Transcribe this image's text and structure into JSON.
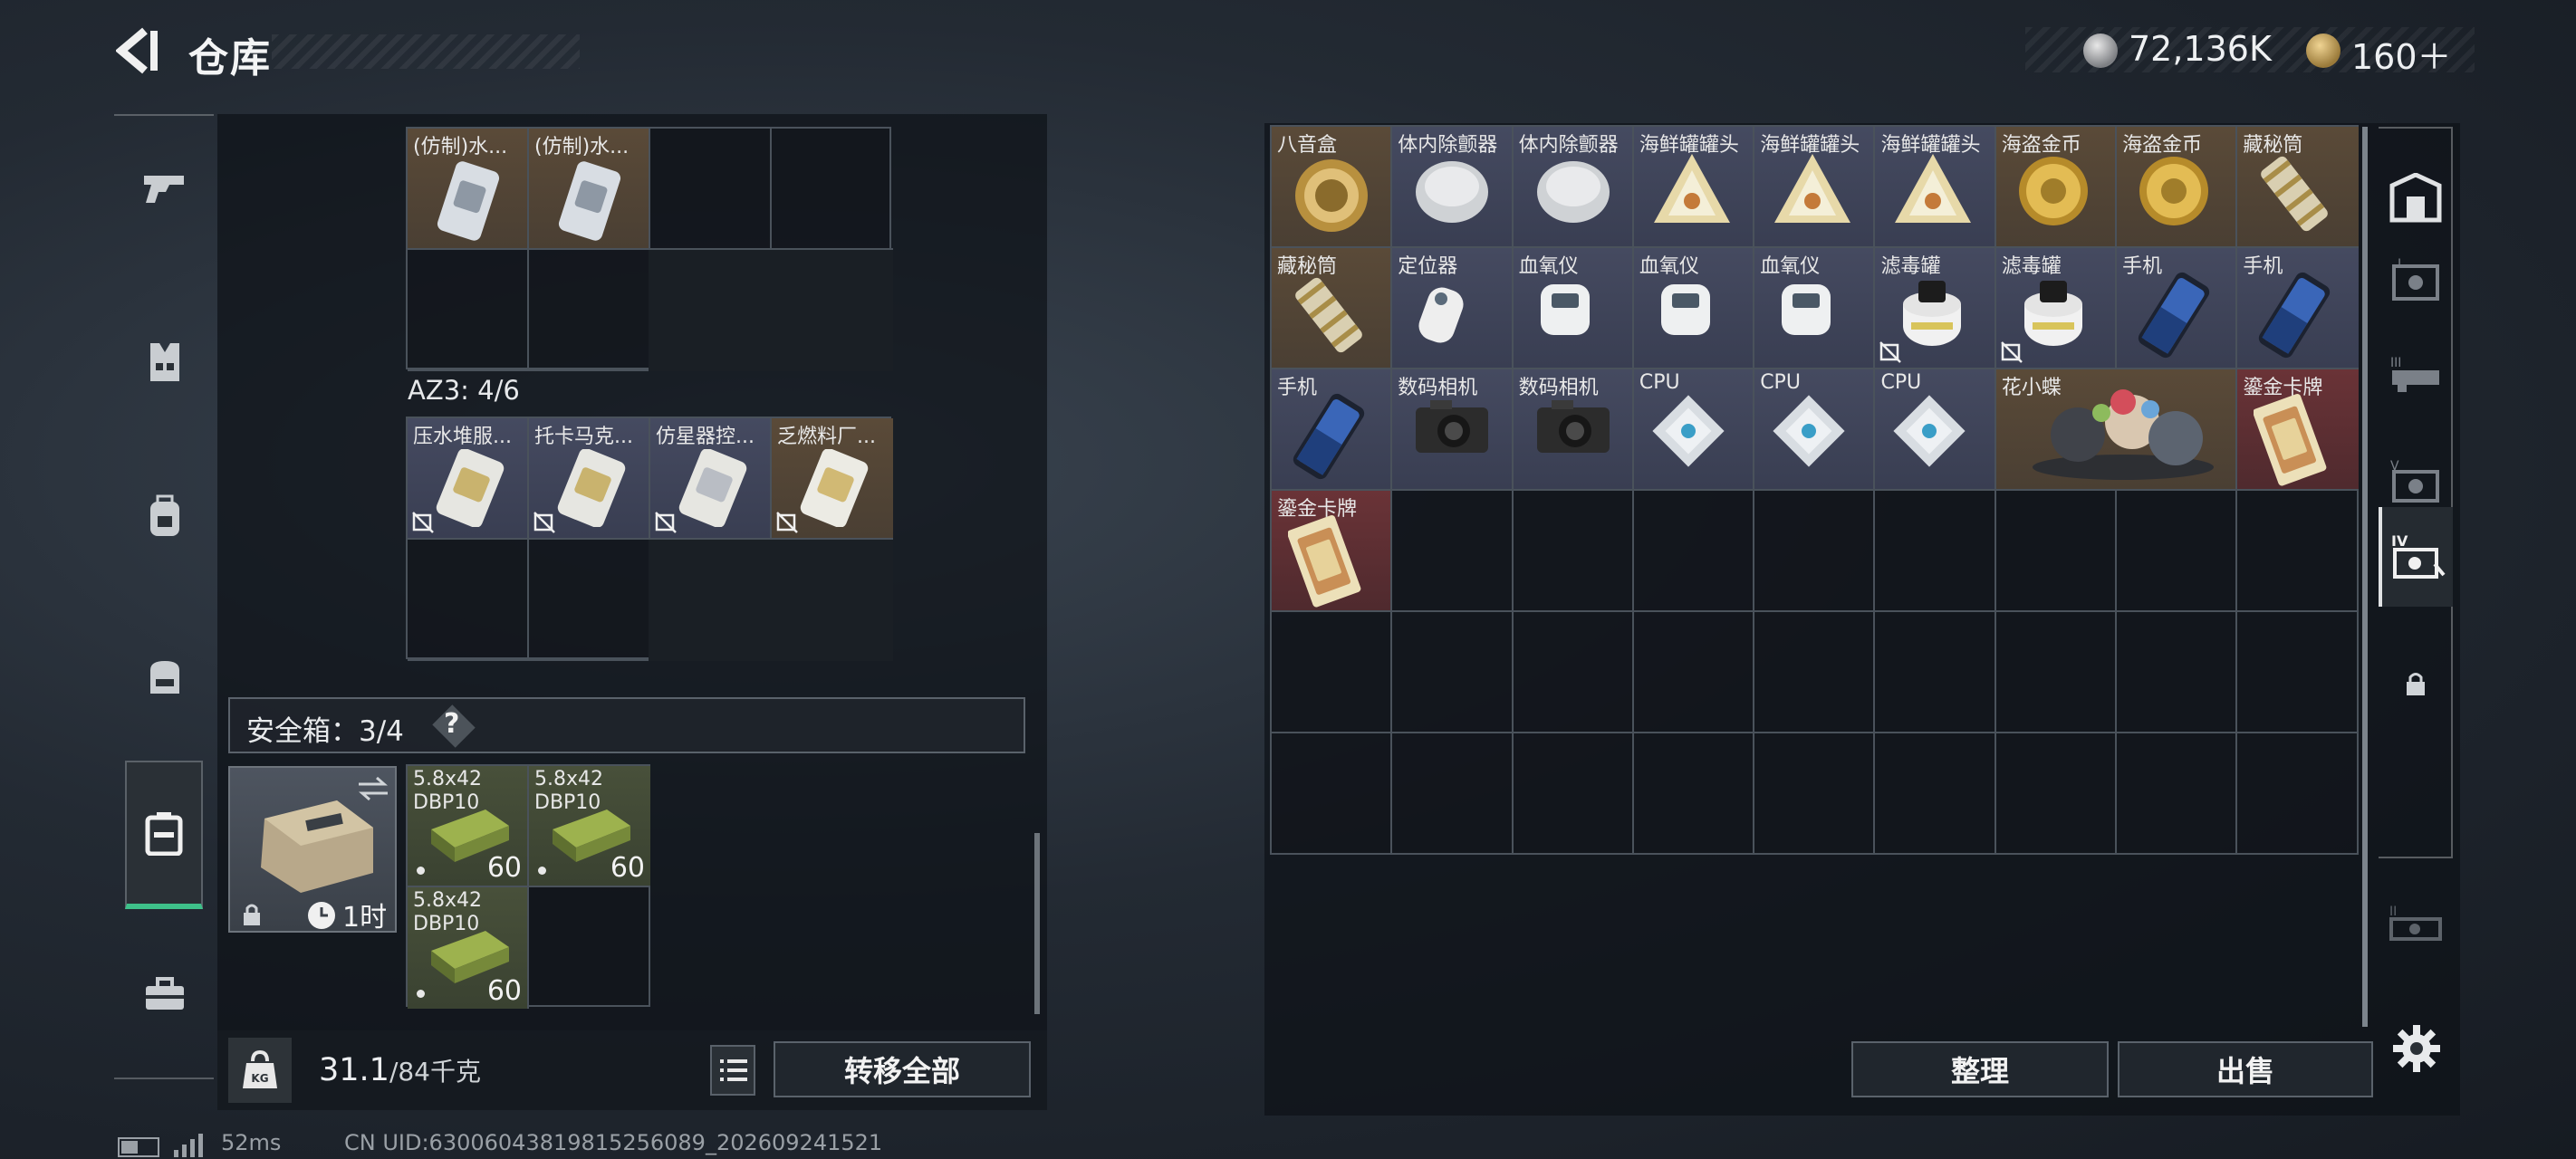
{
  "header": {
    "title": "仓库",
    "currency_main": "72,136K",
    "currency_premium": "160＋"
  },
  "left_nav": {
    "items": [
      "gun-icon",
      "armor-icon",
      "backpack-icon",
      "bag-icon",
      "safe-box-icon",
      "toolbox-icon"
    ],
    "active": "safe-box-icon"
  },
  "container_top": {
    "rows": [
      [
        {
          "name": "(仿制)水...",
          "quality": "brown"
        },
        {
          "name": "(仿制)水...",
          "quality": "brown"
        },
        null,
        null
      ],
      [
        null,
        null
      ]
    ]
  },
  "az3": {
    "label": "AZ3: 4/6",
    "items": [
      {
        "name": "压水堆服...",
        "quality": "violet"
      },
      {
        "name": "托卡马克...",
        "quality": "violet"
      },
      {
        "name": "仿星器控...",
        "quality": "violet"
      },
      {
        "name": "乏燃料厂...",
        "quality": "brown"
      }
    ]
  },
  "safe_box": {
    "label": "安全箱：3/4",
    "help": "?",
    "time_left": "1时",
    "items": [
      {
        "name": "5.8x42",
        "sub": "DBP10",
        "qty": "60"
      },
      {
        "name": "5.8x42",
        "sub": "DBP10",
        "qty": "60"
      },
      {
        "name": "5.8x42",
        "sub": "DBP10",
        "qty": "60"
      }
    ]
  },
  "bottom": {
    "weight_current": "31.1",
    "weight_max": "/84千克",
    "transfer_all": "转移全部"
  },
  "warehouse": {
    "items": [
      {
        "name": "八音盒",
        "quality": "brown",
        "art": "gold-disc"
      },
      {
        "name": "体内除颤器",
        "quality": "violet",
        "art": "silver-disc"
      },
      {
        "name": "体内除颤器",
        "quality": "violet",
        "art": "silver-disc"
      },
      {
        "name": "海鲜罐罐头",
        "quality": "violet",
        "art": "triangle"
      },
      {
        "name": "海鲜罐罐头",
        "quality": "violet",
        "art": "triangle"
      },
      {
        "name": "海鲜罐罐头",
        "quality": "violet",
        "art": "triangle"
      },
      {
        "name": "海盗金币",
        "quality": "brown",
        "art": "gold-coin"
      },
      {
        "name": "海盗金币",
        "quality": "brown",
        "art": "gold-coin"
      },
      {
        "name": "藏秘筒",
        "quality": "brown",
        "art": "cylinder"
      },
      {
        "name": "藏秘筒",
        "quality": "brown",
        "art": "cylinder"
      },
      {
        "name": "定位器",
        "quality": "violet",
        "art": "tag"
      },
      {
        "name": "血氧仪",
        "quality": "violet",
        "art": "oximeter"
      },
      {
        "name": "血氧仪",
        "quality": "violet",
        "art": "oximeter"
      },
      {
        "name": "血氧仪",
        "quality": "violet",
        "art": "oximeter"
      },
      {
        "name": "滤毒罐",
        "quality": "violet",
        "art": "filter",
        "noinsure": true
      },
      {
        "name": "滤毒罐",
        "quality": "violet",
        "art": "filter",
        "noinsure": true
      },
      {
        "name": "手机",
        "quality": "violet",
        "art": "phone"
      },
      {
        "name": "手机",
        "quality": "violet",
        "art": "phone"
      },
      {
        "name": "手机",
        "quality": "violet",
        "art": "phone"
      },
      {
        "name": "数码相机",
        "quality": "violet",
        "art": "camera"
      },
      {
        "name": "数码相机",
        "quality": "violet",
        "art": "camera"
      },
      {
        "name": "CPU",
        "quality": "violet",
        "art": "cpu"
      },
      {
        "name": "CPU",
        "quality": "violet",
        "art": "cpu"
      },
      {
        "name": "CPU",
        "quality": "violet",
        "art": "cpu"
      },
      {
        "name": "花小蝶",
        "quality": "brown",
        "art": "figure",
        "wide": true
      },
      {
        "name": "鎏金卡牌",
        "quality": "maroon",
        "art": "card"
      },
      {
        "name": "鎏金卡牌",
        "quality": "maroon",
        "art": "card"
      }
    ],
    "sort_label": "整理",
    "sell_label": "出售"
  },
  "right_nav": {
    "items": [
      "room-icon",
      "tier-1-icon",
      "tier-3-icon",
      "tier-5-icon",
      "tier-4-icon",
      "lock-icon",
      "tier-2-icon"
    ],
    "active": "tier-4-icon"
  },
  "footer": {
    "ping": "52ms",
    "uid": "CN UID:6300604381981525608​9_202609241521"
  },
  "colors": {
    "accent_green": "#3ec18a",
    "quality_brown": "#5a4a38",
    "quality_violet": "#454a60",
    "quality_maroon": "#6a3337"
  }
}
